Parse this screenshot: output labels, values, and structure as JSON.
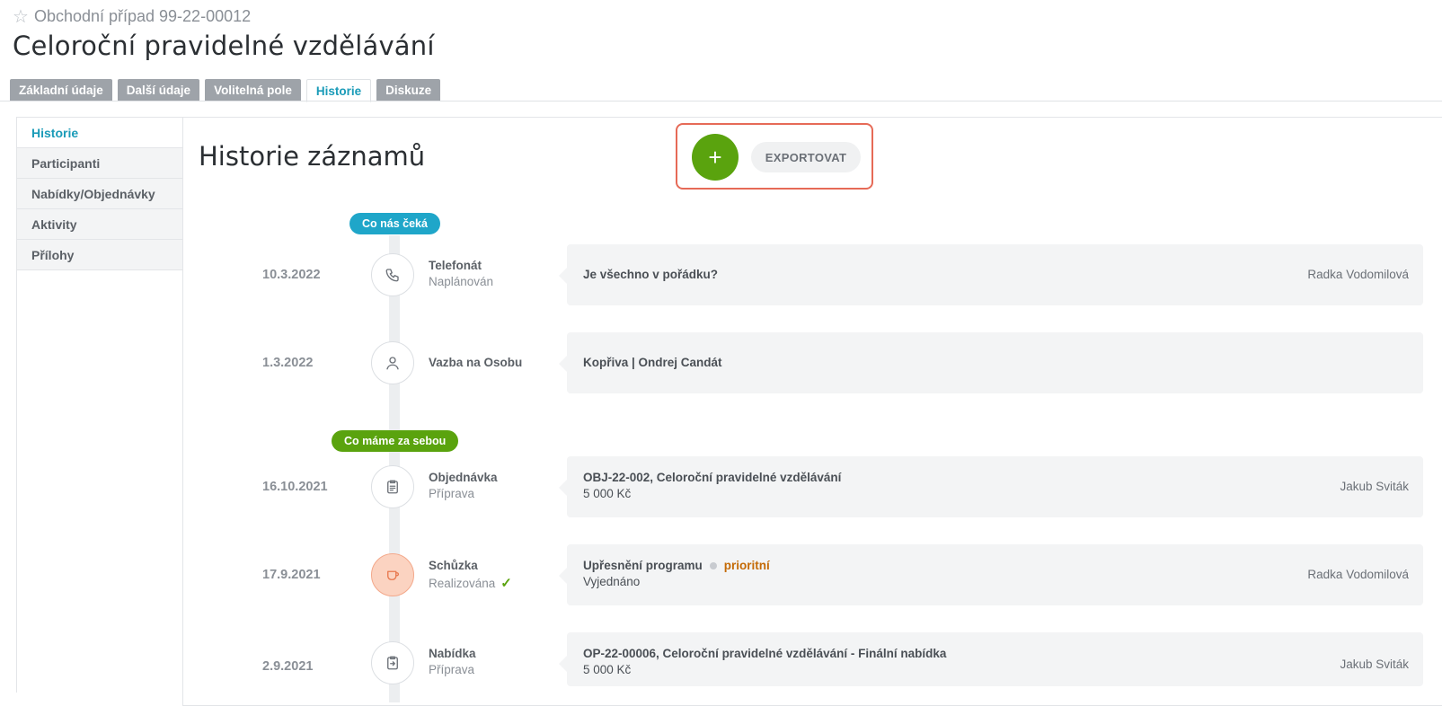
{
  "header": {
    "subtitle": "Obchodní případ 99-22-00012",
    "title": "Celoroční pravidelné vzdělávání"
  },
  "tabs": [
    {
      "label": "Základní údaje"
    },
    {
      "label": "Další údaje"
    },
    {
      "label": "Volitelná pole"
    },
    {
      "label": "Historie",
      "active": true
    },
    {
      "label": "Diskuze"
    }
  ],
  "sidebar": {
    "items": [
      {
        "label": "Historie",
        "active": true
      },
      {
        "label": "Participanti"
      },
      {
        "label": "Nabídky/Objednávky"
      },
      {
        "label": "Aktivity"
      },
      {
        "label": "Přílohy"
      }
    ]
  },
  "main": {
    "title": "Historie záznamů",
    "add_label": "+",
    "export_label": "EXPORTOVAT"
  },
  "timeline": {
    "upcoming_label": "Co nás čeká",
    "past_label": "Co máme za sebou",
    "entries": [
      {
        "date": "10.3.2022",
        "icon": "phone-icon",
        "type": "Telefonát",
        "status": "Naplánován",
        "title": "Je všechno v pořádku?",
        "owner": "Radka Vodomilová"
      },
      {
        "date": "1.3.2022",
        "icon": "person-icon",
        "type": "Vazba na Osobu",
        "status": "",
        "title": "Kopřiva | Ondrej Candát",
        "owner": ""
      },
      {
        "date": "16.10.2021",
        "icon": "order-icon",
        "type": "Objednávka",
        "status": "Příprava",
        "title": "OBJ-22-002, Celoroční pravidelné vzdělávání",
        "subtitle": "5 000 Kč",
        "owner": "Jakub Sviták"
      },
      {
        "date": "17.9.2021",
        "icon": "cup-icon",
        "type": "Schůzka",
        "status": "Realizována",
        "title": "Upřesnění programu",
        "priority": "prioritní",
        "subtitle": "Vyjednáno",
        "owner": "Radka Vodomilová"
      },
      {
        "date": "2.9.2021",
        "icon": "offer-icon",
        "type": "Nabídka",
        "status": "Příprava",
        "title": "OP-22-00006, Celoroční pravidelné vzdělávání - Finální nabídka",
        "subtitle": "5 000 Kč",
        "owner": "Jakub Sviták"
      }
    ]
  }
}
